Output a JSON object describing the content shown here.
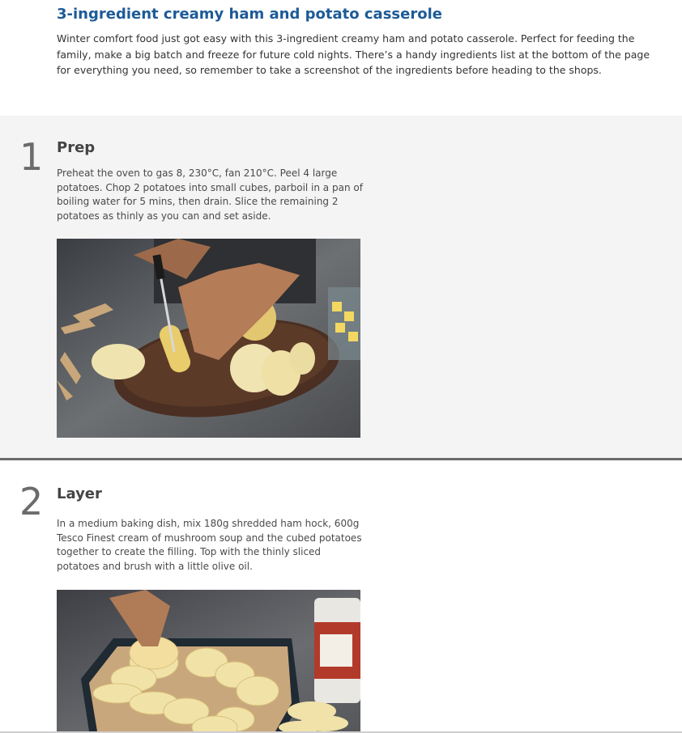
{
  "recipe": {
    "title": "3-ingredient creamy ham and potato casserole",
    "description": "Winter comfort food just got easy with this 3-ingredient creamy ham and potato casserole. Perfect for feeding the family, make a big batch and freeze for future cold nights. There’s a handy ingredients list at the bottom of the page for everything you need, so remember to take a screenshot of the ingredients before heading to the shops."
  },
  "steps": [
    {
      "number": "1",
      "heading": "Prep",
      "text": "Preheat the oven to gas 8, 230°C, fan 210°C. Peel 4 large potatoes. Chop 2 potatoes into small cubes, parboil in a pan of boiling water for 5 mins, then drain. Slice the remaining 2 potatoes as thinly as you can and set aside.",
      "image_icon": "photo-slicing-potatoes"
    },
    {
      "number": "2",
      "heading": "Layer",
      "text": "In a medium baking dish, mix 180g shredded ham hock, 600g Tesco Finest cream of mushroom soup and the cubed potatoes together to create the filling. Top with the thinly sliced potatoes and brush with a little olive oil.",
      "image_icon": "photo-layering-casserole"
    }
  ]
}
